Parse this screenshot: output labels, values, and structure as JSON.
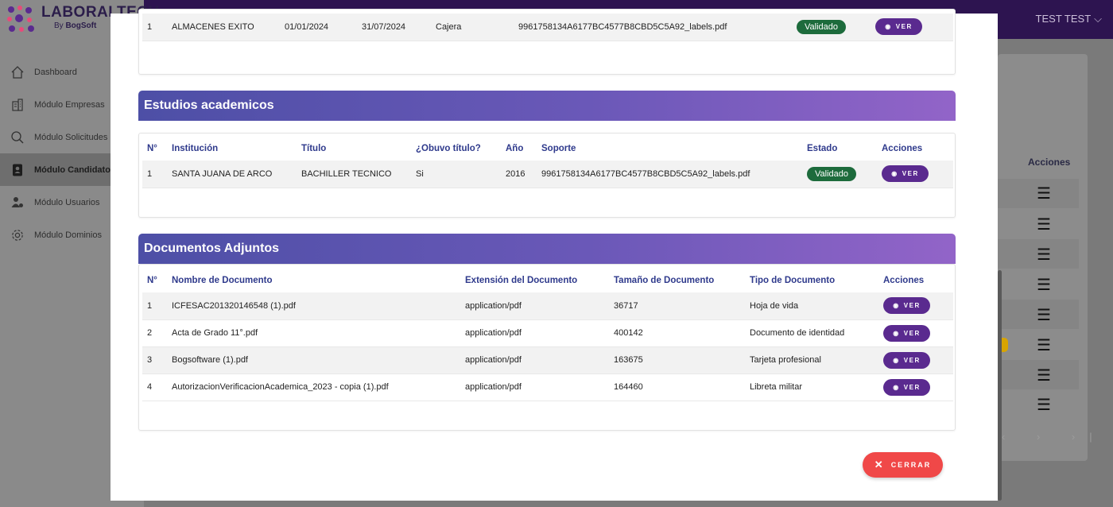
{
  "app": {
    "brand_name": "LABORALTECH",
    "brand_sub_prefix": "By",
    "brand_sub_name": "BogSoft",
    "user_name": "TEST TEST",
    "sidebar": [
      {
        "label": "Dashboard",
        "icon": "home-icon",
        "active": false
      },
      {
        "label": "Módulo Empresas",
        "icon": "building-icon",
        "active": false
      },
      {
        "label": "Módulo Solicitudes",
        "icon": "search-icon",
        "active": false
      },
      {
        "label": "Módulo Candidatos",
        "icon": "id-badge-icon",
        "active": true
      },
      {
        "label": "Módulo Usuarios",
        "icon": "users-icon",
        "active": false
      },
      {
        "label": "Módulo Dominios",
        "icon": "gear-icon",
        "active": false
      }
    ],
    "background_table_header": "Acciones",
    "pager": "‹ › ›|"
  },
  "experience": {
    "row": {
      "num": "1",
      "company": "ALMACENES EXITO",
      "start": "01/01/2024",
      "end": "31/07/2024",
      "role": "Cajera",
      "file": "9961758134A6177BC4577B8CBD5C5A92_labels.pdf",
      "status": "Validado",
      "action": "VER"
    }
  },
  "studies": {
    "title": "Estudios academicos",
    "headers": [
      "N°",
      "Institución",
      "Título",
      "¿Obuvo título?",
      "Año",
      "Soporte",
      "Estado",
      "Acciones"
    ],
    "rows": [
      {
        "num": "1",
        "institution": "SANTA JUANA DE ARCO",
        "title": "BACHILLER TECNICO",
        "obtained": "Si",
        "year": "2016",
        "file": "9961758134A6177BC4577B8CBD5C5A92_labels.pdf",
        "status": "Validado",
        "action": "VER"
      }
    ]
  },
  "documents": {
    "title": "Documentos Adjuntos",
    "headers": [
      "N°",
      "Nombre de Documento",
      "Extensión del Documento",
      "Tamaño de Documento",
      "Tipo de Documento",
      "Acciones"
    ],
    "rows": [
      {
        "num": "1",
        "name": "ICFESAC201320146548 (1).pdf",
        "ext": "application/pdf",
        "size": "36717",
        "type": "Hoja de vida",
        "action": "VER"
      },
      {
        "num": "2",
        "name": "Acta de Grado 11°.pdf",
        "ext": "application/pdf",
        "size": "400142",
        "type": "Documento de identidad",
        "action": "VER"
      },
      {
        "num": "3",
        "name": "Bogsoftware (1).pdf",
        "ext": "application/pdf",
        "size": "163675",
        "type": "Tarjeta profesional",
        "action": "VER"
      },
      {
        "num": "4",
        "name": "AutorizacionVerificacionAcademica_2023 - copia (1).pdf",
        "ext": "application/pdf",
        "size": "164460",
        "type": "Libreta militar",
        "action": "VER"
      }
    ]
  },
  "close_label": "CERRAR",
  "colors": {
    "accent": "#5a2a8f",
    "success": "#1d6b3c",
    "danger": "#f04848",
    "header_start": "#4d4fa6",
    "header_end": "#9264c8"
  }
}
